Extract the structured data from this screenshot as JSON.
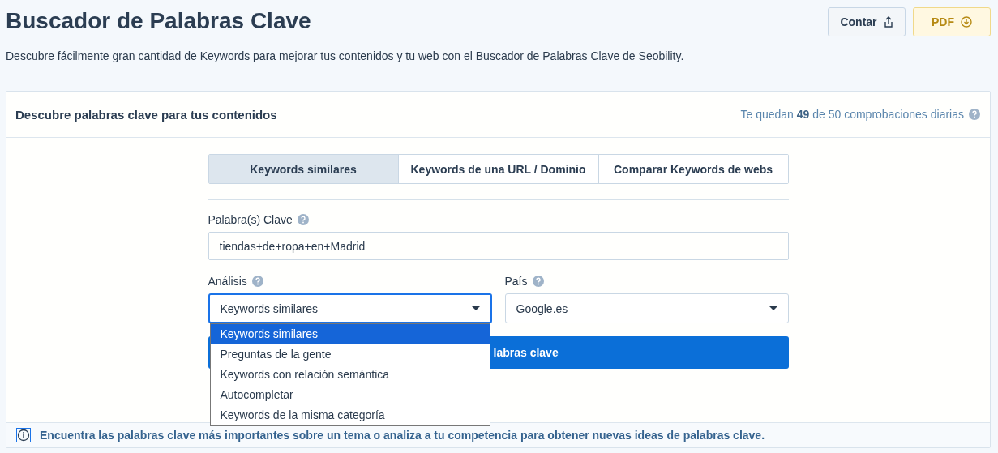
{
  "header": {
    "title": "Buscador de Palabras Clave",
    "buttons": [
      {
        "label": "Contar",
        "kind": "share"
      },
      {
        "label": "PDF",
        "kind": "download"
      }
    ],
    "description": "Descubre fácilmente gran cantidad de Keywords para mejorar tus contenidos y tu web con el Buscador de Palabras Clave de Seobility."
  },
  "card": {
    "title": "Descubre palabras clave para tus contenidos",
    "quota": "Te quedan **49** de 50 comprobaciones diarias",
    "tabs": [
      {
        "label": "Keywords similares",
        "selected": true
      },
      {
        "label": "Keywords de una URL / Dominio",
        "selected": false
      },
      {
        "label": "Comparar Keywords de webs",
        "selected": false
      }
    ],
    "keyword_field": {
      "label": "Palabra(s) Clave",
      "value": "tiendas+de+ropa+en+Madrid"
    },
    "analysis_select": {
      "label": "Análisis",
      "value": "Keywords similares",
      "expanded": true,
      "options": [
        {
          "label": "Keywords similares",
          "selected": true
        },
        {
          "label": "Preguntas de la gente",
          "selected": false
        },
        {
          "label": "Keywords con relación semántica",
          "selected": false
        },
        {
          "label": "Autocompletar",
          "selected": false
        },
        {
          "label": "Keywords de la misma categoría",
          "selected": false
        }
      ]
    },
    "country_select": {
      "label": "País",
      "value": "Google.es"
    },
    "search_button": "labras clave",
    "info": "Encuentra las palabras clave más importantes sobre un tema o analiza a tu competencia para obtener nuevas ideas de palabras clave."
  }
}
